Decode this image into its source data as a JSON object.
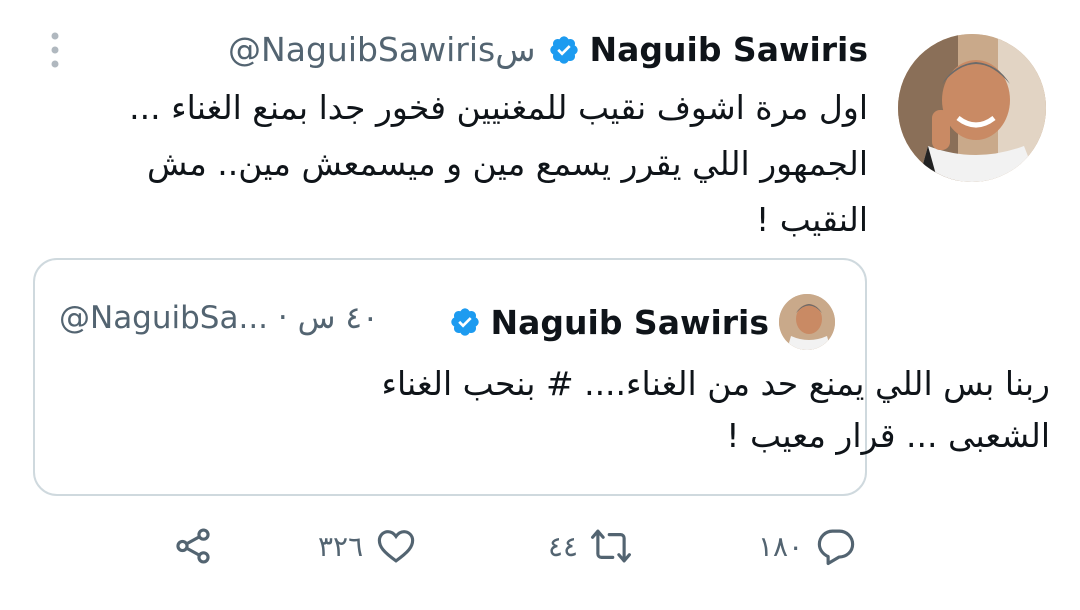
{
  "tweet": {
    "author_name": "Naguib Sawiris",
    "author_handle": "@NaguibSawirisس",
    "text": "اول مرة اشوف نقيب للمغنيين فخور جدا بمنع الغناء ... الجمهور اللي يقرر يسمع مين و ميسمعش مين.. مش النقيب !"
  },
  "quote": {
    "author_name": "Naguib Sawiris",
    "meta": "@NaguibSa... · ٤٠ س",
    "text_line1": "ربنا بس اللي يمنع حد من الغناء.... # بنحب الغناء",
    "text_line2": "الشعبى ... قرار معيب !"
  },
  "actions": {
    "reply_count": "١٨٠",
    "retweet_count": "٤٤",
    "like_count": "٣٢٦"
  },
  "icons": {
    "verified": "verified-badge-icon",
    "more": "more-vertical-icon",
    "reply": "reply-icon",
    "retweet": "retweet-icon",
    "like": "heart-icon",
    "share": "share-icon"
  },
  "colors": {
    "verified_blue": "#1d9bf0",
    "text_primary": "#0f1419",
    "text_secondary": "#536471",
    "border": "#cfd9de"
  }
}
